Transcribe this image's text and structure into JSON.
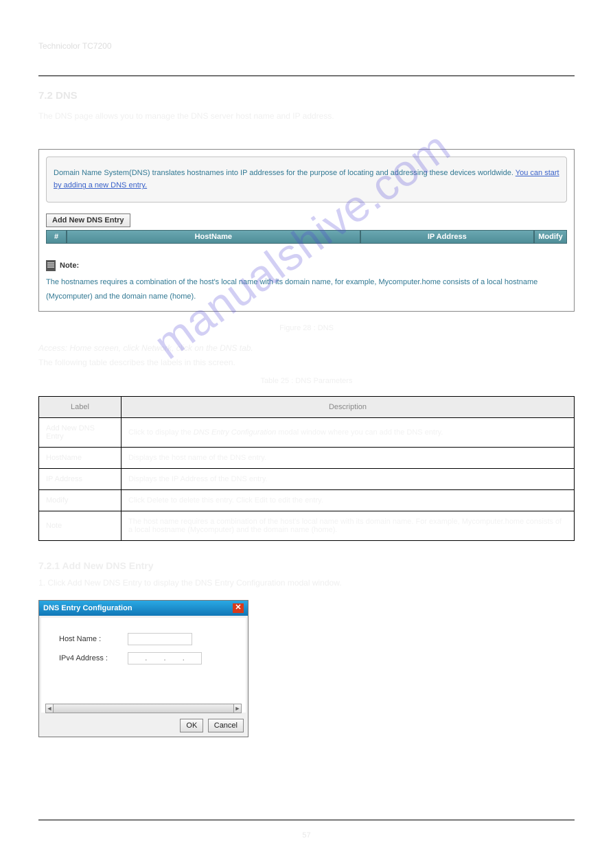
{
  "watermark": "manualshive.com",
  "header": {
    "model": "Technicolor TC7200"
  },
  "section": {
    "title": "7.2 DNS",
    "intro": "The DNS page allows you to manage the DNS server host name and IP address."
  },
  "screenshot1": {
    "description": "Domain Name System(DNS) translates hostnames into IP addresses for the purpose of locating and addressing these devices worldwide. ",
    "description_link": "You can start by adding a new DNS entry.",
    "add_button": "Add New DNS Entry",
    "columns": {
      "num": "#",
      "hostname": "HostName",
      "ip": "IP Address",
      "modify": "Modify"
    },
    "note_label": "Note:",
    "note_text": "The hostnames requires a combination of the host's local name with its domain name, for example, Mycomputer.home consists of a local hostname (Mycomputer) and the domain name (home)."
  },
  "fig1_caption": "Figure 28 : DNS",
  "ghost_access": "Access: Home screen, click Network, click on the DNS tab.",
  "params": {
    "heading": "The following table describes the labels in this screen.",
    "caption": "Table 25 : DNS Parameters",
    "head_label": "Label",
    "head_desc": "Description",
    "rows": [
      {
        "label": "Add New DNS Entry",
        "desc_prefix": "Click to display the ",
        "desc_ital": "DNS Entry Configuration",
        "desc_suffix": " modal window where you can add the DNS entry."
      },
      {
        "label": "HostName",
        "desc": "Displays the host name of the DNS entry."
      },
      {
        "label": "IP Address",
        "desc": "Displays the IP Address of the DNS entry."
      },
      {
        "label": "Modify",
        "desc": "Click Delete to delete this entry. Click Edit to edit the entry."
      },
      {
        "label": "Note",
        "desc": "The host name requires a combination of the host's local name with its domain name. For example, Mycomputer.home consists of a local hostname (Mycomputer) and the domain name (home)."
      }
    ]
  },
  "subsection": {
    "title": "7.2.1 Add New DNS Entry",
    "step1": "1.  Click Add New DNS Entry to display the DNS Entry Configuration modal window."
  },
  "dialog": {
    "title": "DNS Entry Configuration",
    "host_label": "Host Name :",
    "ip_label": "IPv4 Address :",
    "ip_placeholder": ". . .",
    "ok": "OK",
    "cancel": "Cancel"
  },
  "page_number": "57"
}
